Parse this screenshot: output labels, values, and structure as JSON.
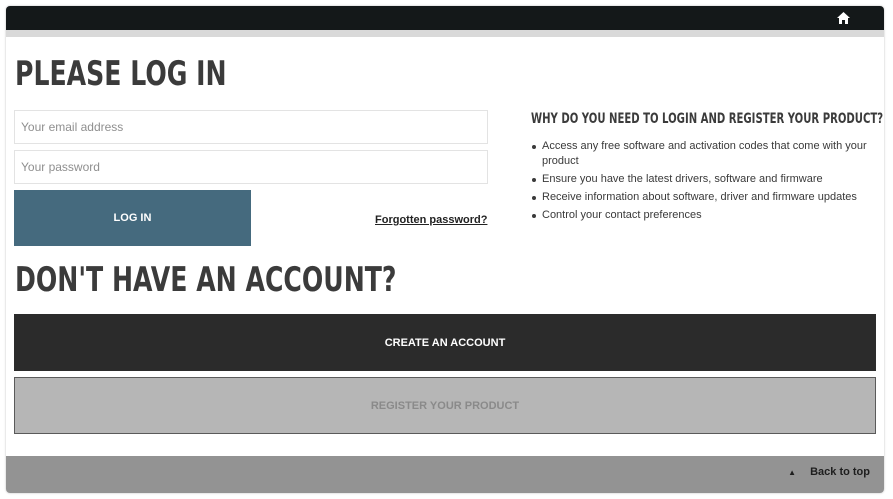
{
  "header": {
    "home_icon": "home-icon"
  },
  "login": {
    "title": "PLEASE LOG IN",
    "email_placeholder": "Your email address",
    "password_placeholder": "Your password",
    "login_label": "LOG IN",
    "forgot_label": "Forgotten password?"
  },
  "why": {
    "title": "WHY DO YOU NEED TO LOGIN AND REGISTER YOUR PRODUCT?",
    "items": [
      "Access any free software and activation codes that come with your product",
      "Ensure you have the latest drivers, software and firmware",
      "Receive information about software, driver and firmware updates",
      "Control your contact preferences"
    ]
  },
  "account": {
    "title": "DON'T HAVE AN ACCOUNT?",
    "create_label": "CREATE AN ACCOUNT",
    "register_label": "REGISTER YOUR PRODUCT"
  },
  "footer": {
    "back_to_top_label": "Back to top",
    "up_icon": "triangle-up-icon"
  },
  "colors": {
    "topbar": "#141819",
    "login_button": "#456a7e",
    "create_button": "#2b2b2b",
    "register_button": "#b6b6b6",
    "footer": "#939393"
  }
}
